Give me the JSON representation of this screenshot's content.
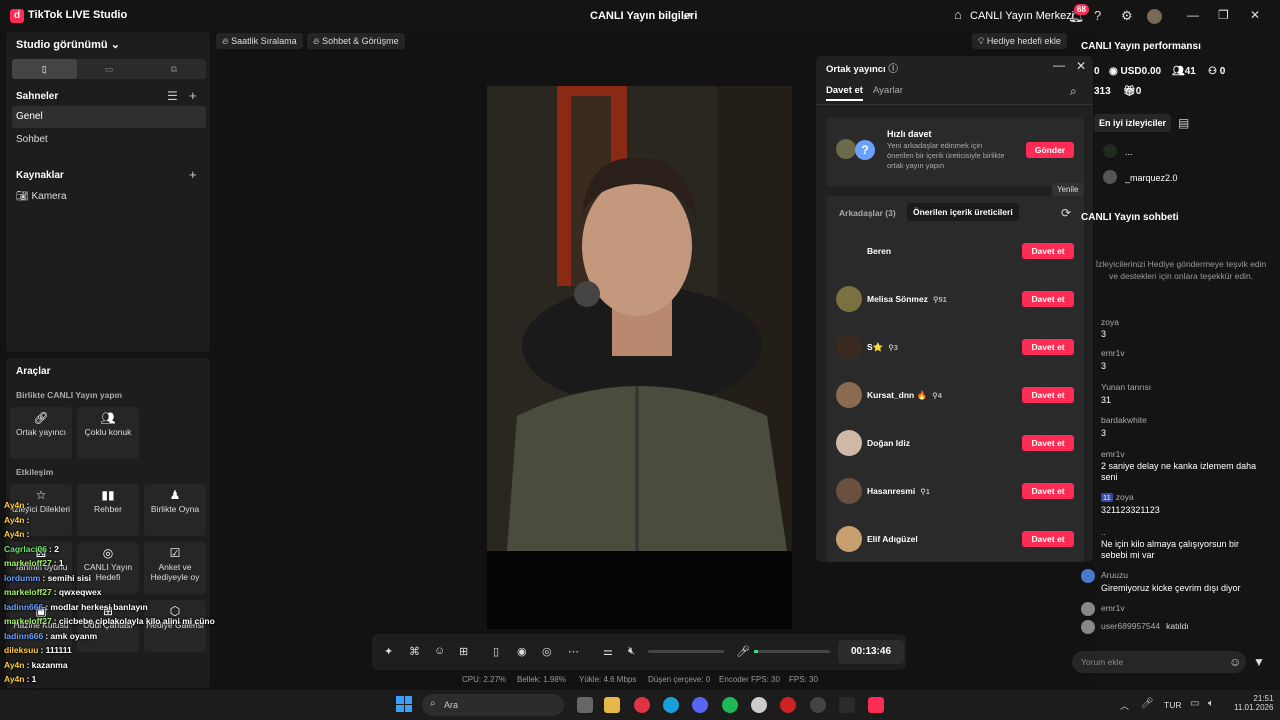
{
  "app": {
    "logo": "d",
    "title": "TikTok LIVE Studio",
    "center_title": "CANLI Yayın bilgileri",
    "live_center": "CANLI Yayın Merkezi",
    "notif_count": "68"
  },
  "left": {
    "studio_view": "Studio görünümü",
    "scenes_title": "Sahneler",
    "scenes": [
      "Genel",
      "Sohbet"
    ],
    "sources_title": "Kaynaklar",
    "sources": [
      "Kamera"
    ],
    "tools_title": "Araçlar",
    "together_title": "Birlikte CANLI Yayın yapın",
    "together_tools": [
      "Ortak yayıncı",
      "Çoklu konuk"
    ],
    "interaction_title": "Etkileşim",
    "interaction_tools": [
      "İzleyici Dilekleri",
      "Rehber",
      "Birlikte Oyna",
      "Tahmin oyunu",
      "CANLI Yayın Hedefi",
      "Anket ve Hediyeyle oy",
      "Hazine Kutusu",
      "Ödül Çantası",
      "Hediye Galerisi"
    ]
  },
  "pills": {
    "hourly": "Saatlik Sıralama",
    "chat": "Sohbet & Görüşme",
    "gift_goal": "Hediye hedefi ekle"
  },
  "overlay_chat": [
    {
      "user": "Ay4n",
      "msg": ":"
    },
    {
      "user": "Ay4n",
      "msg": ":"
    },
    {
      "user": "Ay4n",
      "msg": ":"
    },
    {
      "user": "Cagrlaci06",
      "msg": ": 2"
    },
    {
      "user": "markeloff27",
      "msg": ": 1"
    },
    {
      "user": "lordumm",
      "msg": ": semihi sisi"
    },
    {
      "user": "markeloff27",
      "msg": ": qwxeqwex"
    },
    {
      "user": "ladinn666",
      "msg": ": modlar herkesi banlayın"
    },
    {
      "user": "markeloff27",
      "msg": ": ciicbebe ciplakolayla kilo alini mi cüno"
    },
    {
      "user": "ladinn666",
      "msg": ": amk oyanm"
    },
    {
      "user": "dileksuu",
      "msg": ": 111111"
    },
    {
      "user": "Ay4n",
      "msg": ": kazanma"
    },
    {
      "user": "Ay4n",
      "msg": ": 1"
    },
    {
      "user": "ladinn666",
      "msg": ""
    },
    {
      "user": "sexyburak",
      "msg": ": önceden almış yetkiyi"
    }
  ],
  "controls": {
    "timer": "00:13:46"
  },
  "stats": {
    "cpu": "CPU: 2.27%",
    "memory": "Bellek: 1.98%",
    "upload": "Yükle: 4.6 Mbps",
    "dropped": "Düşen çerçeve: 0",
    "encoder_fps": "Encoder FPS: 30",
    "fps": "FPS: 30"
  },
  "modal": {
    "title": "Ortak yayıncı",
    "tab_invite": "Davet et",
    "tab_settings": "Ayarlar",
    "quick_title": "Hızlı davet",
    "quick_desc": "Yeni arkadaşlar edinmek için önerilen bir içerik üreticisiyle birlikte ortak yayın yapın",
    "send": "Gönder",
    "friends_tab": "Arkadaşlar (3)",
    "suggested_tab": "Önerilen içerik üreticileri",
    "refresh_tooltip": "Yenile",
    "invite_label": "Davet et",
    "rows": [
      {
        "name": "Beren",
        "badge": ""
      },
      {
        "name": "Melisa Sönmez",
        "badge": "51"
      },
      {
        "name": "S⭐",
        "badge": "3"
      },
      {
        "name": "Kursat_dnn 🔥",
        "badge": "4"
      },
      {
        "name": "Doğan Idiz",
        "badge": ""
      },
      {
        "name": "Hasanresmi",
        "badge": "1"
      },
      {
        "name": "Elif Adıgüzel",
        "badge": ""
      }
    ]
  },
  "right": {
    "perf_title": "CANLI Yayın performansı",
    "stats": [
      "0",
      "USD0.00",
      "41",
      "0",
      "313",
      "0"
    ],
    "top_viewers": "En iyi izleyiciler",
    "top_viewer_list": [
      "...",
      "_marquez2.0"
    ],
    "chat_title": "CANLI Yayın sohbeti",
    "chat_hint": "İzleyicilerinizi Hediye göndermeye teşvik edin ve destekleri için onlara teşekkür edin.",
    "messages": [
      {
        "user": "zoya",
        "msg": "3"
      },
      {
        "user": "emr1v",
        "msg": "3"
      },
      {
        "user": "Yunan tanrısı",
        "msg": "31"
      },
      {
        "user": "bardakwhite",
        "msg": "3"
      },
      {
        "user": "emr1v",
        "msg": "2 saniye delay ne kanka izlemem daha seni"
      },
      {
        "user": "zoya",
        "msg": "321123321123",
        "badge": "11"
      },
      {
        "user": "..",
        "msg": "Ne için kilo almaya çalışıyorsun bir sebebi mi var"
      },
      {
        "user": "Aruuzu",
        "msg": "Giremiyoruz kicke çevrim dışı diyor"
      },
      {
        "user": "emr1v",
        "msg": ""
      },
      {
        "user": "user689957544",
        "msg": "katıldı"
      }
    ],
    "comment_placeholder": "Yorum ekle"
  },
  "taskbar": {
    "search": "Ara",
    "lang": "TUR",
    "time": "21:51",
    "date": "11.01.2026"
  },
  "colors": {
    "accent": "#fe2c55",
    "bg": "#121212"
  }
}
